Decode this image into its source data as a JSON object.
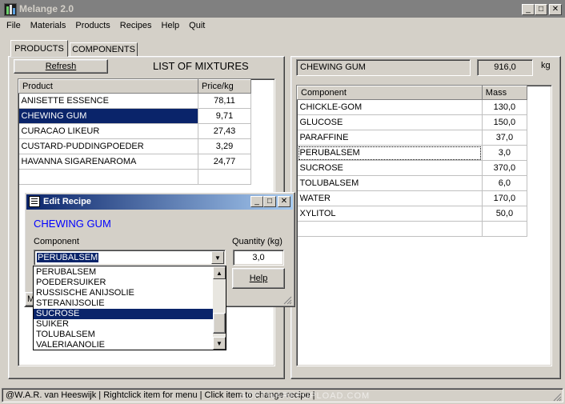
{
  "window": {
    "title": "Melange 2.0",
    "min": "_",
    "max": "□",
    "close": "✕"
  },
  "menu": [
    "File",
    "Materials",
    "Products",
    "Recipes",
    "Help",
    "Quit"
  ],
  "tabs": [
    "PRODUCTS",
    "COMPONENTS"
  ],
  "refresh_label": "Refresh",
  "list_title": "LIST OF MIXTURES",
  "products": {
    "headers": [
      "Product",
      "Price/kg"
    ],
    "rows": [
      [
        "ANISETTE ESSENCE",
        "78,11"
      ],
      [
        "CHEWING GUM",
        "9,71"
      ],
      [
        "CURACAO LIKEUR",
        "27,43"
      ],
      [
        "CUSTARD-PUDDINGPOEDER",
        "3,29"
      ],
      [
        "HAVANNA SIGARENAROMA",
        "24,77"
      ]
    ]
  },
  "recipe": {
    "name": "CHEWING GUM",
    "total": "916,0",
    "unit": "kg",
    "headers": [
      "Component",
      "Mass"
    ],
    "rows": [
      [
        "CHICKLE-GOM",
        "130,0"
      ],
      [
        "GLUCOSE",
        "150,0"
      ],
      [
        "PARAFFINE",
        "37,0"
      ],
      [
        "PERUBALSEM",
        "3,0"
      ],
      [
        "SUCROSE",
        "370,0"
      ],
      [
        "TOLUBALSEM",
        "6,0"
      ],
      [
        "WATER",
        "170,0"
      ],
      [
        "XYLITOL",
        "50,0"
      ]
    ]
  },
  "dialog": {
    "title": "Edit Recipe",
    "product": "CHEWING GUM",
    "component_label": "Component",
    "quantity_label": "Quantity (kg)",
    "component_value": "PERUBALSEM",
    "quantity_value": "3,0",
    "help_label": "Help",
    "hidden_button_partial": "M",
    "options": [
      "PERUBALSEM",
      "POEDERSUIKER",
      "RUSSISCHE ANIJSOLIE",
      "STERANIJSOLIE",
      "SUCROSE",
      "SUIKER",
      "TOLUBALSEM",
      "VALERIAANOLIE"
    ],
    "selected_option": "SUCROSE"
  },
  "status": "@W.A.R. van Heeswijk |  Rightclick item for menu |  Click item to change recipe |",
  "watermark": "SOFTWAREPUPLOAD.COM",
  "colors": {
    "selection": "#0a246a",
    "dialog_title_blue": "#0000ff",
    "titlebar": "#808080"
  }
}
